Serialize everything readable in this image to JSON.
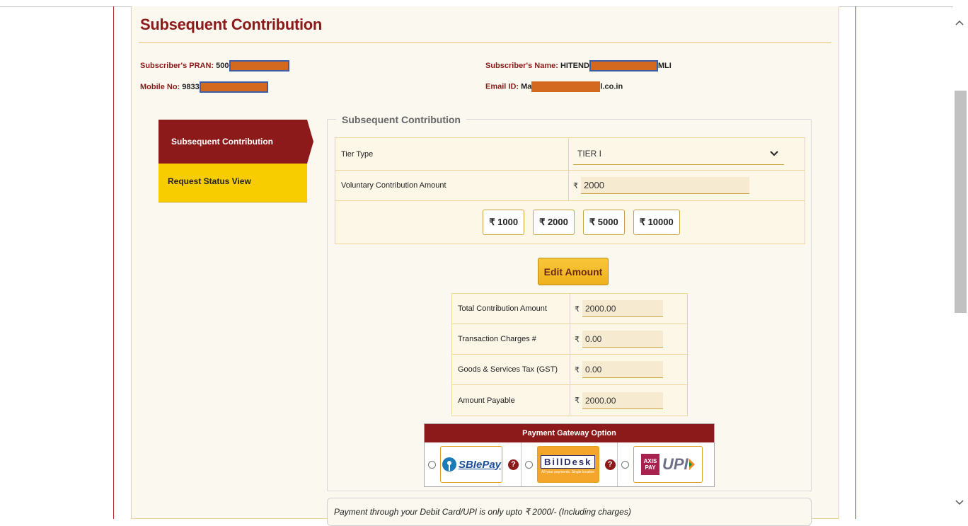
{
  "page": {
    "title": "Subsequent Contribution",
    "pran_label": "Subscriber's PRAN: ",
    "pran_value": "500",
    "name_label": "Subscriber's Name: ",
    "name_prefix": "HITEND",
    "name_suffix": "MLI",
    "mobile_label": "Mobile No: ",
    "mobile_value": "9833",
    "email_label": "Email ID: ",
    "email_prefix": "Ma",
    "email_suffix": "l.co.in"
  },
  "sidebar": {
    "items": [
      {
        "label": "Subsequent Contribution"
      },
      {
        "label": "Request Status View"
      }
    ]
  },
  "form": {
    "legend": "Subsequent Contribution",
    "tier_label": "Tier Type",
    "tier_value": "TIER I",
    "voluntary_label": "Voluntary Contribution Amount",
    "currency": "₹",
    "voluntary_value": "2000",
    "quick_amounts": [
      "₹ 1000",
      "₹ 2000",
      "₹ 5000",
      "₹ 10000"
    ],
    "edit_button": "Edit Amount"
  },
  "totals": {
    "rows": [
      {
        "label": "Total Contribution Amount",
        "value": "2000.00"
      },
      {
        "label": "Transaction Charges #",
        "value": "0.00"
      },
      {
        "label": "Goods & Services Tax (GST)",
        "value": "0.00"
      },
      {
        "label": "Amount Payable",
        "value": "2000.00"
      }
    ]
  },
  "gateway": {
    "title": "Payment Gateway Option",
    "options": [
      {
        "name": "SBIePay",
        "icon": "sbiepay-logo"
      },
      {
        "name": "BillDesk",
        "tagline": "All your payments. Single location",
        "icon": "billdesk-logo"
      },
      {
        "name": "UPI",
        "bank": "AXIS PAY",
        "icon": "axis-upi-logo"
      }
    ],
    "help_glyph": "?"
  },
  "note": {
    "text": "Payment through your Debit Card/UPI is only upto ₹ 2000/- (Including charges)"
  },
  "scroll": {
    "up_glyph": "^",
    "down_glyph": "v"
  }
}
